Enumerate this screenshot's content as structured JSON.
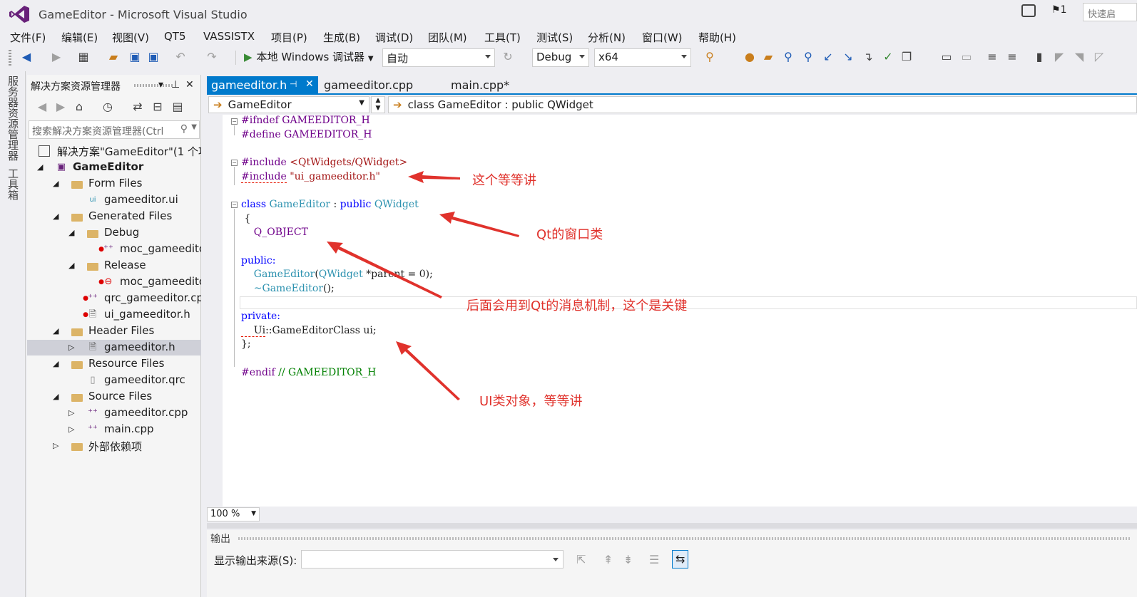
{
  "window": {
    "title": "GameEditor - Microsoft Visual Studio",
    "notification_count": "1",
    "quick_launch": "快速启"
  },
  "menu": [
    "文件(F)",
    "编辑(E)",
    "视图(V)",
    "QT5",
    "VASSISTX",
    "项目(P)",
    "生成(B)",
    "调试(D)",
    "团队(M)",
    "工具(T)",
    "测试(S)",
    "分析(N)",
    "窗口(W)",
    "帮助(H)"
  ],
  "toolbar": {
    "run_label": "本地 Windows 调试器",
    "solution_config_combo": "自动",
    "configuration": "Debug",
    "platform": "x64"
  },
  "left_strip": {
    "server_explorer": "服务器资源管理器",
    "toolbox": "工具箱"
  },
  "solution_explorer": {
    "title": "解决方案资源管理器",
    "search_placeholder": "搜索解决方案资源管理器(Ctrl",
    "tree": [
      {
        "label": "解决方案\"GameEditor\"(1 个项",
        "level": 0
      },
      {
        "label": "GameEditor",
        "level": 0
      },
      {
        "label": "Form Files",
        "level": 1
      },
      {
        "label": "gameeditor.ui",
        "level": 2
      },
      {
        "label": "Generated Files",
        "level": 1
      },
      {
        "label": "Debug",
        "level": 2
      },
      {
        "label": "moc_gameedito",
        "level": 3
      },
      {
        "label": "Release",
        "level": 2
      },
      {
        "label": "moc_gameedito",
        "level": 3
      },
      {
        "label": "qrc_gameeditor.cp",
        "level": 2
      },
      {
        "label": "ui_gameeditor.h",
        "level": 2
      },
      {
        "label": "Header Files",
        "level": 1
      },
      {
        "label": "gameeditor.h",
        "level": 2
      },
      {
        "label": "Resource Files",
        "level": 1
      },
      {
        "label": "gameeditor.qrc",
        "level": 2
      },
      {
        "label": "Source Files",
        "level": 1
      },
      {
        "label": "gameeditor.cpp",
        "level": 2
      },
      {
        "label": "main.cpp",
        "level": 2
      },
      {
        "label": "外部依赖项",
        "level": 1
      }
    ]
  },
  "editor": {
    "tabs": [
      {
        "label": "gameeditor.h",
        "active": true
      },
      {
        "label": "gameeditor.cpp",
        "active": false
      },
      {
        "label": "main.cpp*",
        "active": false
      }
    ],
    "nav_scope": "GameEditor",
    "nav_member": "class GameEditor : public QWidget",
    "zoom": "100 %",
    "code": {
      "l1_pp": "#ifndef",
      "l1_rest": " GAMEEDITOR_H",
      "l2_pp": "#define",
      "l2_rest": " GAMEEDITOR_H",
      "l4_pp": "#include",
      "l4_str": " <QtWidgets/QWidget>",
      "l5_pp": "#include",
      "l5_str": " \"ui_gameeditor.h\"",
      "l7_kw": "class",
      "l7_ty": " GameEditor",
      "l7_mid": " : ",
      "l7_kw2": "public",
      "l7_ty2": " QWidget",
      "l8": " {",
      "l9": "    Q_OBJECT",
      "l11": "public:",
      "l12_ty": "    GameEditor",
      "l12_a": "(",
      "l12_ty2": "QWidget",
      "l12_b": " *parent = 0);",
      "l13_ty": "    ~GameEditor",
      "l13_b": "();",
      "l15": "private:",
      "l16_a": "    Ui",
      "l16_b": "::GameEditorClass ui;",
      "l17": "};",
      "l19_pp": "#endif",
      "l19_cm": " // GAMEEDITOR_H"
    },
    "annotations": {
      "include_note": "这个等等讲",
      "class_note": "Qt的窗口类",
      "qobject_note": "后面会用到Qt的消息机制，这个是关键",
      "ui_note": "UI类对象，等等讲"
    },
    "annotation_color": "#e0322c"
  },
  "output": {
    "title": "输出",
    "source_label": "显示输出来源(S):",
    "source_value": ""
  },
  "colors": {
    "accent": "#007acc",
    "keyword": "#0000ff",
    "preprocessor": "#6f008a",
    "string": "#a31515",
    "type": "#2b91af",
    "comment": "#008000"
  }
}
